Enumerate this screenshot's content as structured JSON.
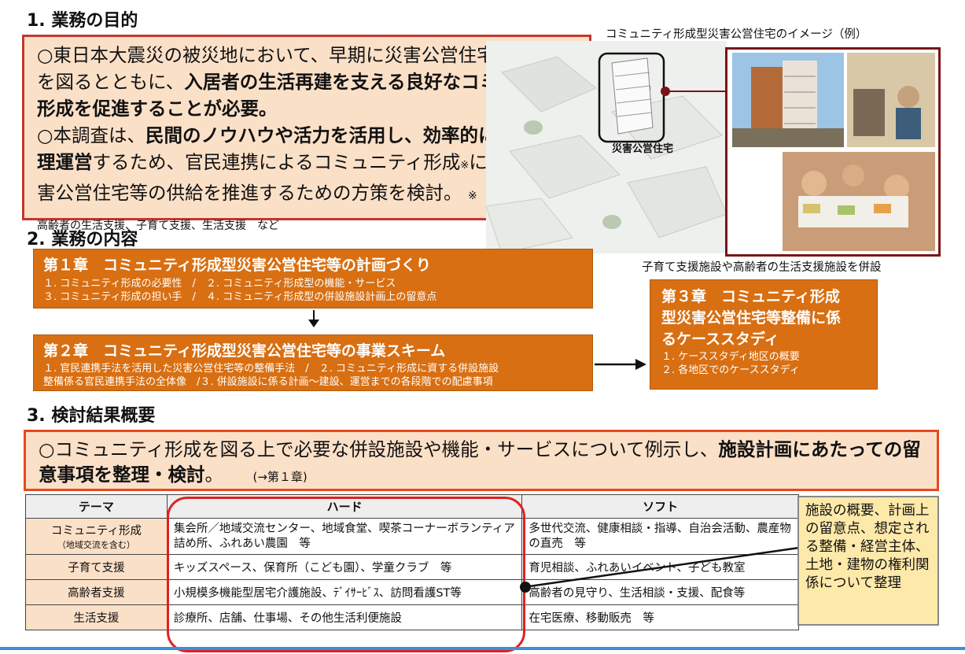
{
  "section1": {
    "title": "1. 業務の目的",
    "para1_pre": "○東日本大震災の被災地において、早期に災害公営住宅等の供給を図るとともに、",
    "para1_bold": "入居者の生活再建を支える良好なコミュニティ形成を促進することが必要。",
    "para2_pre": "○本調査は、",
    "para2_bold1": "民間のノウハウや活力を活用し、効率的に整備、管理運営",
    "para2_mid": "するため、官民連携によるコミュニティ形成",
    "para2_mark": "※",
    "para2_post": "に資する災害公営住宅等の供給を推進するための方策を検討。",
    "note": "※　地域交流の促進、高齢者の生活支援、子育て支援、生活支援　など"
  },
  "image_area": {
    "caption": "コミュニティ形成型災害公営住宅のイメージ（例）",
    "building_label": "災害公営住宅",
    "bottom_caption": "子育て支援施設や高齢者の生活支援施設を併設"
  },
  "section2": {
    "title": "2. 業務の内容",
    "ch1": {
      "title": "第１章　コミュニティ形成型災害公営住宅等の計画づくり",
      "line1": "１. コミュニティ形成の必要性　/　２. コミュニティ形成型の機能・サービス",
      "line2": "３. コミュニティ形成の担い手　/　４. コミュニティ形成型の併設施設計画上の留意点"
    },
    "ch2": {
      "title": "第２章　コミュニティ形成型災害公営住宅等の事業スキーム",
      "line1": "１. 官民連携手法を活用した災害公営住宅等の整備手法　/　２. コミュニティ形成に資する併設施設",
      "line2": "整備係る官民連携手法の全体像　/３. 併設施設に係る計画～建設、運営までの各段階での配慮事項"
    },
    "ch3": {
      "title_l1": "第３章　コミュニティ形成",
      "title_l2": "型災害公営住宅等整備に係",
      "title_l3": "るケーススタディ",
      "line1": "１. ケーススタディ地区の概要",
      "line2": "２. 各地区でのケーススタディ"
    }
  },
  "section3": {
    "title": "3. 検討結果概要",
    "summary_pre": "○コミュニティ形成を図る上で必要な併設施設や機能・サービスについて例示し、",
    "summary_bold": "施設計画にあたっての留意事項を整理・検討",
    "summary_post": "。",
    "summary_ref": "(→第１章)"
  },
  "table": {
    "headers": [
      "テーマ",
      "ハード",
      "ソフト"
    ],
    "rows": [
      {
        "theme": "コミュニティ形成",
        "theme_sub": "（地域交流を含む）",
        "hard": "集会所／地域交流センター、地域食堂、喫茶コーナーボランティア詰め所、ふれあい農園　等",
        "soft": "多世代交流、健康相談・指導、自治会活動、農産物の直売　等"
      },
      {
        "theme": "子育て支援",
        "theme_sub": "",
        "hard": "キッズスペース、保育所（こども園）、学童クラブ　等",
        "soft": "育児相談、ふれあいイベント、子ども教室"
      },
      {
        "theme": "高齢者支援",
        "theme_sub": "",
        "hard": "小規模多機能型居宅介護施設、ﾃﾞｲｻｰﾋﾞｽ、訪問看護ST等",
        "soft": "高齢者の見守り、生活相談・支援、配食等"
      },
      {
        "theme": "生活支援",
        "theme_sub": "",
        "hard": "診療所、店舗、仕事場、その他生活利便施設",
        "soft": "在宅医療、移動販売　等"
      }
    ]
  },
  "callout": {
    "text": "施設の概要、計画上の留意点、想定される整備・経営主体、土地・建物の権利関係について整理"
  },
  "colors": {
    "chapter_orange": "#d86f12",
    "box_peach": "#fbe0c8",
    "border_red": "#c0392b",
    "note_yellow": "#fde9a9",
    "bottom_blue": "#3d8fd4"
  }
}
